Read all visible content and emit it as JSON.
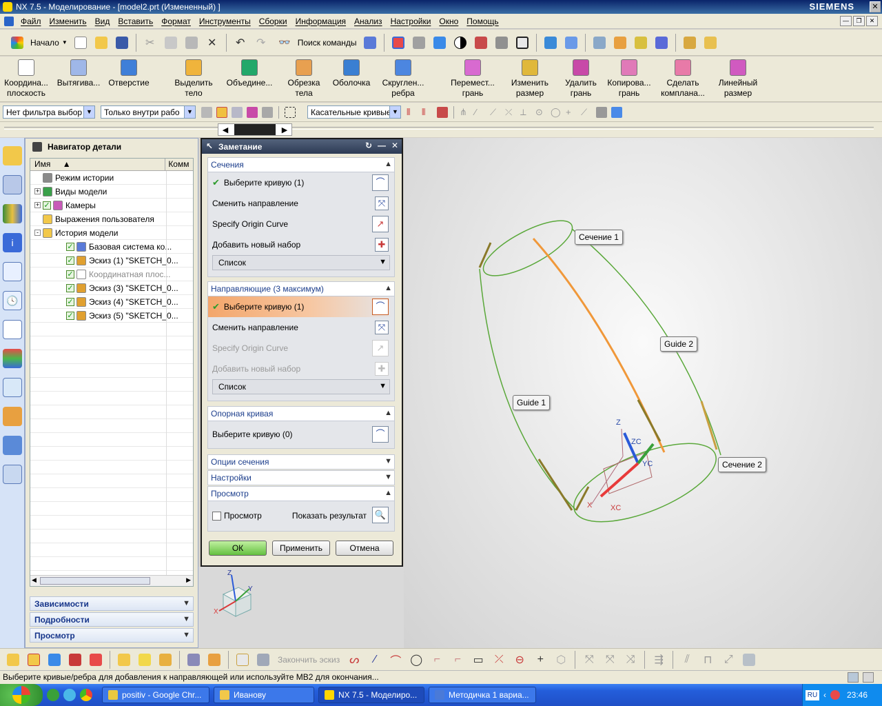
{
  "window": {
    "title": "NX 7.5 - Моделирование - [model2.prt (Измененный) ]",
    "brand": "SIEMENS"
  },
  "menu": [
    "Файл",
    "Изменить",
    "Вид",
    "Вставить",
    "Формат",
    "Инструменты",
    "Сборки",
    "Информация",
    "Анализ",
    "Настройки",
    "Окно",
    "Помощь"
  ],
  "toolbar1": {
    "start_label": "Начало",
    "search_label": "Поиск команды"
  },
  "toolbar2": [
    {
      "label1": "Координа...",
      "label2": "плоскость",
      "icon": "datum-plane-icon",
      "color": "#ffffff"
    },
    {
      "label1": "Вытягива...",
      "label2": "",
      "icon": "extrude-icon",
      "color": "#9fb7e8"
    },
    {
      "label1": "Отверстие",
      "label2": "",
      "icon": "hole-icon",
      "color": "#3f7fd8"
    },
    {
      "label1": "Выделить",
      "label2": "тело",
      "icon": "extract-body-icon",
      "color": "#f0b43c"
    },
    {
      "label1": "Объедине...",
      "label2": "",
      "icon": "unite-icon",
      "color": "#22a86a"
    },
    {
      "label1": "Обрезка",
      "label2": "тела",
      "icon": "trim-body-icon",
      "color": "#e8a050"
    },
    {
      "label1": "Оболочка",
      "label2": "",
      "icon": "shell-icon",
      "color": "#3a7fd2"
    },
    {
      "label1": "Скруглен...",
      "label2": "ребра",
      "icon": "edge-blend-icon",
      "color": "#4c86e0"
    },
    {
      "label1": "Перемест...",
      "label2": "грань",
      "icon": "move-face-icon",
      "color": "#d86ad0"
    },
    {
      "label1": "Изменить",
      "label2": "размер",
      "icon": "resize-icon",
      "color": "#e0b83a"
    },
    {
      "label1": "Удалить",
      "label2": "грань",
      "icon": "delete-face-icon",
      "color": "#c84aa8"
    },
    {
      "label1": "Копирова...",
      "label2": "грань",
      "icon": "copy-face-icon",
      "color": "#e07ab8"
    },
    {
      "label1": "Сделать",
      "label2": "компланa...",
      "icon": "make-coplanar-icon",
      "color": "#e87aa8"
    },
    {
      "label1": "Линейный",
      "label2": "размер",
      "icon": "linear-dimension-icon",
      "color": "#d05ac0"
    }
  ],
  "filters": {
    "type_filter": "Нет фильтра выбор",
    "scope_filter": "Только внутри рабо",
    "curve_rule": "Касательные кривые"
  },
  "navigator": {
    "title": "Навигатор детали",
    "col_name": "Имя",
    "col_comment": "Комм",
    "rows": [
      {
        "label": "Режим истории",
        "level": 1,
        "expander": "",
        "checked": false,
        "disabled": false,
        "icon": "clock-icon",
        "color": "#8a8a8a"
      },
      {
        "label": "Виды модели",
        "level": 1,
        "expander": "+",
        "checked": false,
        "disabled": false,
        "icon": "model-views-icon",
        "color": "#3aa04a"
      },
      {
        "label": "Камеры",
        "level": 1,
        "expander": "+",
        "checked": true,
        "disabled": false,
        "icon": "camera-icon",
        "color": "#c85ab8"
      },
      {
        "label": "Выражения пользователя",
        "level": 1,
        "expander": "",
        "checked": false,
        "disabled": false,
        "icon": "folder-icon",
        "color": "#f2c84a"
      },
      {
        "label": "История модели",
        "level": 1,
        "expander": "-",
        "checked": false,
        "disabled": false,
        "icon": "folder-open-icon",
        "color": "#f2c84a"
      },
      {
        "label": "Базовая система ко...",
        "level": 2,
        "expander": "",
        "checked": true,
        "disabled": false,
        "icon": "datum-csys-icon",
        "color": "#5a7ad8"
      },
      {
        "label": "Эскиз (1) \"SKETCH_0...",
        "level": 2,
        "expander": "",
        "checked": true,
        "disabled": false,
        "icon": "sketch-icon",
        "color": "#e0a030"
      },
      {
        "label": "Координатная плос...",
        "level": 2,
        "expander": "",
        "checked": true,
        "disabled": true,
        "icon": "datum-plane-icon",
        "color": "#ffffff"
      },
      {
        "label": "Эскиз (3) \"SKETCH_0...",
        "level": 2,
        "expander": "",
        "checked": true,
        "disabled": false,
        "icon": "sketch-icon",
        "color": "#e0a030"
      },
      {
        "label": "Эскиз (4) \"SKETCH_0...",
        "level": 2,
        "expander": "",
        "checked": true,
        "disabled": false,
        "icon": "sketch-icon",
        "color": "#e0a030"
      },
      {
        "label": "Эскиз (5) \"SKETCH_0...",
        "level": 2,
        "expander": "",
        "checked": true,
        "disabled": false,
        "icon": "sketch-icon",
        "color": "#e0a030"
      }
    ],
    "sections": [
      "Зависимости",
      "Подробности",
      "Просмотр"
    ]
  },
  "dialog": {
    "title": "Заметание",
    "sections_group": {
      "title": "Сечения",
      "select_curve": "Выберите кривую (1)",
      "reverse": "Сменить направление",
      "origin": "Specify Origin Curve",
      "add_set": "Добавить новый набор",
      "list": "Список"
    },
    "guides_group": {
      "title": "Направляющие (3 максимум)",
      "select_curve": "Выберите кривую (1)",
      "reverse": "Сменить направление",
      "origin": "Specify Origin Curve",
      "add_set": "Добавить новый набор",
      "list": "Список"
    },
    "spine_group": {
      "title": "Опорная кривая",
      "select_curve": "Выберите кривую (0)"
    },
    "section_options": "Опции сечения",
    "settings": "Настройки",
    "preview_group": {
      "title": "Просмотр",
      "preview_checkbox": "Просмотр",
      "show_result": "Показать результат"
    },
    "ok": "ОК",
    "apply": "Применить",
    "cancel": "Отмена"
  },
  "viewport": {
    "labels": {
      "section1": "Сечение 1",
      "section2": "Сечение 2",
      "guide1": "Guide 1",
      "guide2": "Guide 2"
    },
    "axes": {
      "z": "Z",
      "zc": "ZC",
      "yc": "YC",
      "x": "X",
      "xc": "XC"
    },
    "triad": {
      "z": "Z",
      "y": "Y",
      "x": "X"
    },
    "colors": {
      "curve": "#5aa83a",
      "highlight": "#f0983a",
      "arrow": "#8a7a2a"
    }
  },
  "bottom_toolbar": {
    "finish_sketch": "Закончить эскиз"
  },
  "status": "Выберите кривые/ребра для добавления к направляющей или используйте MB2 для окончания...",
  "taskbar": {
    "tasks": [
      {
        "label": "positiv - Google Chr...",
        "color": "#e8c840"
      },
      {
        "label": "Иванову",
        "color": "#f2c84a"
      },
      {
        "label": "NX 7.5 - Моделиро...",
        "color": "#ffd700"
      },
      {
        "label": "Методичка 1 вариа...",
        "color": "#4a7ad8"
      }
    ],
    "lang": "RU",
    "clock": "23:46"
  }
}
